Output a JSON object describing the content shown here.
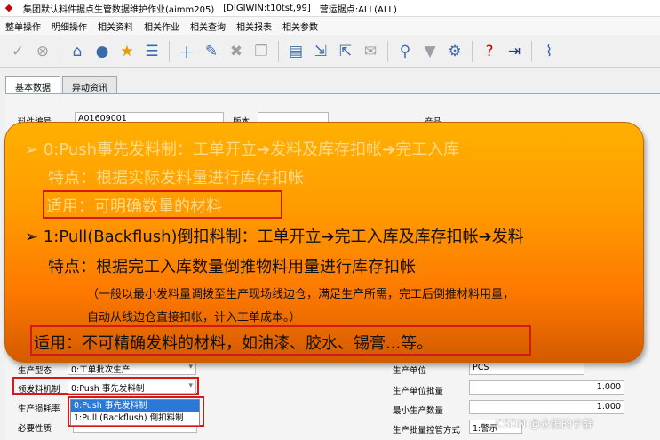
{
  "window": {
    "title": "集团默认料件据点生管数据维护作业(aimm205)",
    "server": "[DIGIWIN:t10tst,99]",
    "site": "营运据点:ALL(ALL)"
  },
  "menu": [
    "整单操作",
    "明细操作",
    "相关资料",
    "相关作业",
    "相关查询",
    "相关报表",
    "相关参数"
  ],
  "toolbar": {
    "icons": [
      "check-icon",
      "cancel-icon",
      "home-icon",
      "location-icon",
      "star-icon",
      "list-icon",
      "add-icon",
      "edit-icon",
      "delete-icon",
      "copy-icon",
      "print-icon",
      "export-icon",
      "import-icon",
      "email-icon",
      "search-icon",
      "filter-icon",
      "settings-icon",
      "help-icon",
      "exit-icon",
      "attachment-icon"
    ]
  },
  "tabs": [
    "基本数据",
    "异动资讯"
  ],
  "form": {
    "item_no_label": "料件编号",
    "item_no_value": "A01609001",
    "version_label": "版本",
    "product_label": "产品",
    "production_type_label": "生产型态",
    "production_type_value": "0:工单批次生产",
    "issue_mechanism_label": "领发料机制",
    "issue_mechanism_value": "0:Push 事先发料制",
    "loss_rate_label": "生产损耗率",
    "required_label": "必要性质",
    "unit_label": "生产单位",
    "unit_value": "PCS",
    "batch_label": "生产单位批量",
    "batch_value": "1.000",
    "min_batch_label": "最小生产数量",
    "min_batch_value": "1.000",
    "batch_ctrl_label": "生产批量控管方式",
    "batch_ctrl_value": "1:警示"
  },
  "dropdown_options": [
    "0:Push 事先发料制",
    "1:Pull (Backflush) 倒扣料制"
  ],
  "callout": {
    "line1": "➢ 0:Push事先发料制：工单开立➔发料及库存扣帐➔完工入库",
    "line2": "特点：根据实际发料量进行库存扣帐",
    "line3": "适用：可明确数量的材料",
    "line4": "➢ 1:Pull(Backflush)倒扣料制：工单开立➔完工入库及库存扣帐➔发料",
    "line5": "特点：根据完工入库数量倒推物料用量进行库存扣帐",
    "line6": "（一般以最小发料量调拨至生产现场线边仓，满足生产所需，完工后倒推材料用量，",
    "line7": "自动从线边仓直接扣帐，计入工单成本。）",
    "line8": "适用：不可精确发料的材料，如油漆、胶水、锡膏...等。"
  },
  "watermark": "CSDN @永恒的宁静"
}
